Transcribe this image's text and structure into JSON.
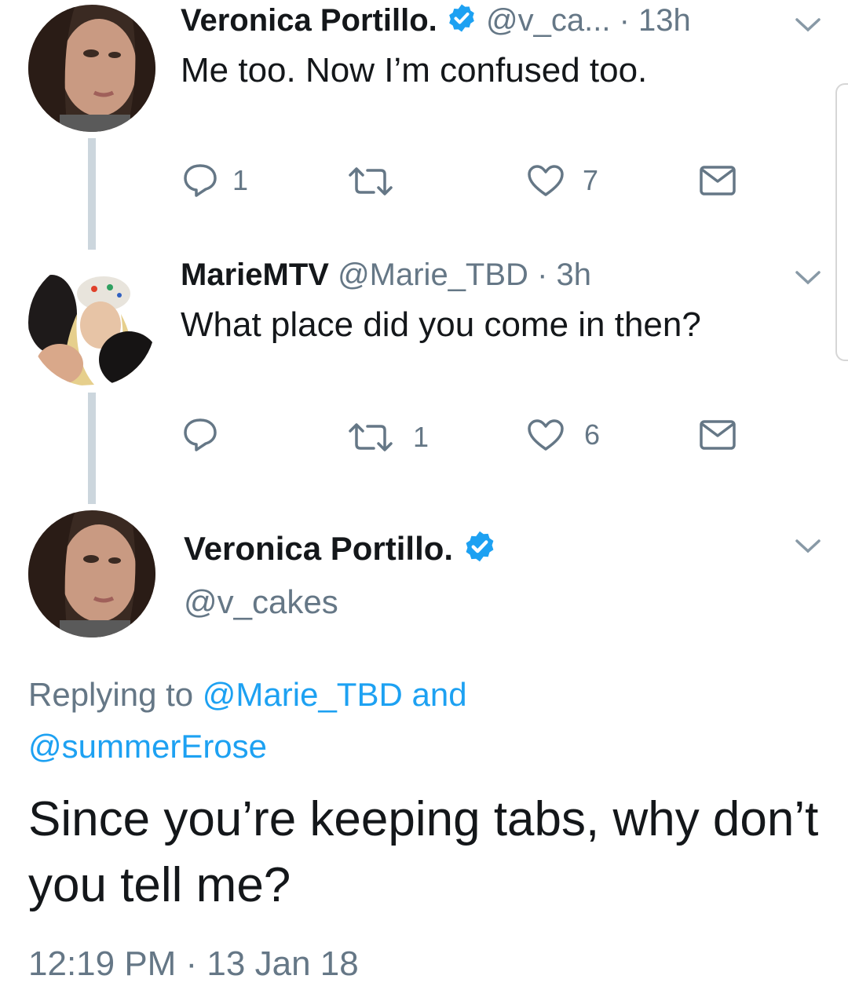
{
  "tweets": [
    {
      "name": "Veronica Portillo.",
      "handle": "@v_ca...",
      "sep": "·",
      "time": "13h",
      "text": "Me too.  Now I’m confused too.",
      "reply_count": "1",
      "retweet_count": "",
      "like_count": "7"
    },
    {
      "name": "MarieMTV",
      "handle": "@Marie_TBD",
      "sep": "·",
      "time": "3h",
      "text": "What place did you come in then?",
      "reply_count": "",
      "retweet_count": "1",
      "like_count": "6"
    }
  ],
  "main_tweet": {
    "name": "Veronica Portillo.",
    "handle": "@v_cakes",
    "replying_prefix": "Replying to",
    "replying_to_1": "@Marie_TBD",
    "replying_and": "and",
    "replying_to_2": "@summerErose",
    "text": "Since you’re keeping tabs, why don’t you tell me?",
    "timestamp": "12:19 PM · 13 Jan 18"
  },
  "colors": {
    "verified_blue": "#1da1f2",
    "text_primary": "#14171a",
    "text_secondary": "#657786",
    "thread_line": "#ccd6dd"
  },
  "icons": [
    "chevron-down-icon",
    "verified-badge-icon",
    "reply-icon",
    "retweet-icon",
    "like-icon",
    "dm-icon"
  ]
}
